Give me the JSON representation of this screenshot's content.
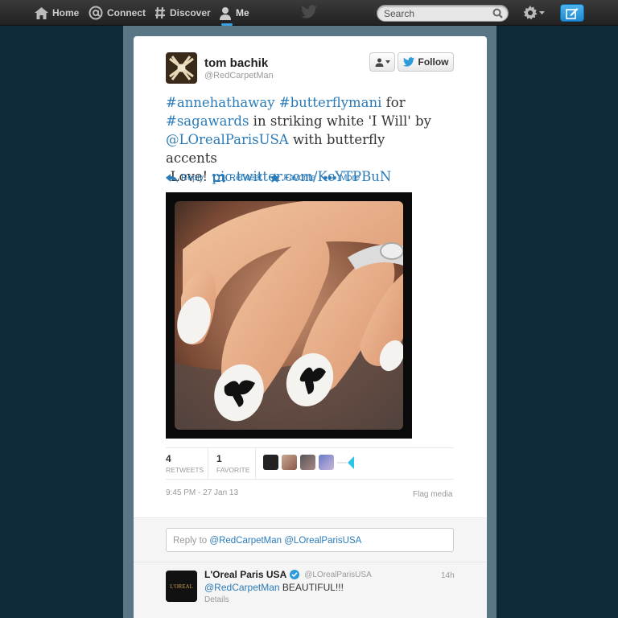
{
  "nav": {
    "home": "Home",
    "connect": "Connect",
    "discover": "Discover",
    "me": "Me",
    "search_placeholder": "Search"
  },
  "tweet": {
    "author_name": "tom bachik",
    "author_handle": "@RedCarpetMan",
    "follow_label": "Follow",
    "text_parts": {
      "hashtag1": "#annehathaway",
      "hashtag2": "#butterflymani",
      "for": " for",
      "hashtag3": "#sagawards",
      "middle": " in striking white 'I Will' by",
      "mention": "@LOrealParisUSA",
      "after_mention": " with butterfly accents",
      "love": "-Love! ",
      "link": "pic.twitter.com/KcYTPBuN"
    },
    "actions": {
      "reply": "Reply",
      "retweet": "Retweet",
      "favorite": "Favorite",
      "more": "More"
    },
    "stats": {
      "retweets_count": "4",
      "retweets_label": "RETWEETS",
      "favorites_count": "1",
      "favorites_label": "FAVORITE"
    },
    "timestamp": "9:45 PM - 27 Jan 13",
    "flag_media": "Flag media"
  },
  "reply_box": {
    "prefix": "Reply to ",
    "handles": "@RedCarpetMan @LOrealParisUSA"
  },
  "reply": {
    "avatar_text": "L'OREAL",
    "name": "L'Oreal Paris USA",
    "handle": "@LOrealParisUSA",
    "time": "14h",
    "mention": "@RedCarpetMan",
    "text": " BEAUTIFUL!!!",
    "details": "Details"
  },
  "colors": {
    "link": "#2b7bb9",
    "background": "#0e2a3a",
    "accent": "#3aa0e0"
  }
}
